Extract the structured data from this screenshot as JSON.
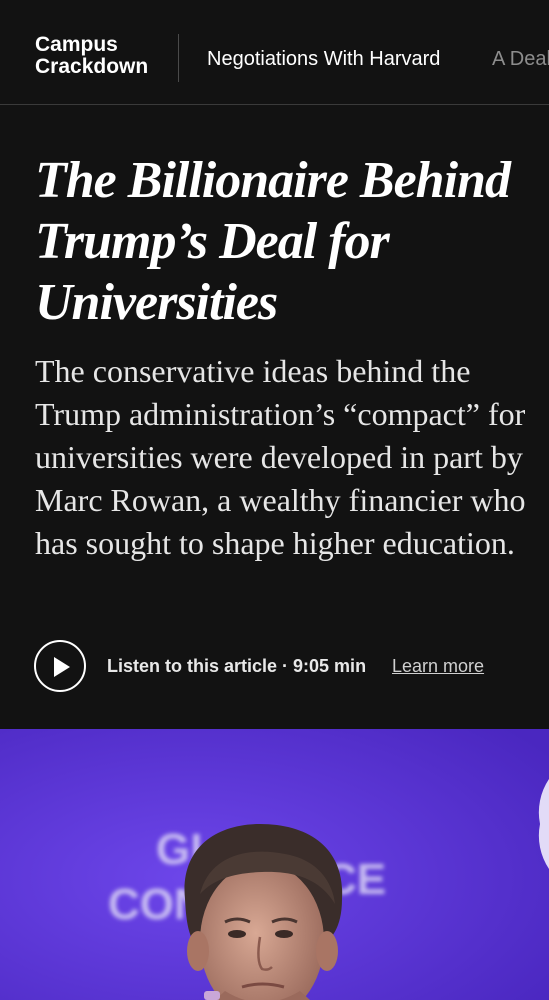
{
  "header": {
    "section_name": "Campus Crackdown",
    "nav_links": [
      "Negotiations With Harvard",
      "A Deal"
    ]
  },
  "article": {
    "headline": "The Billionaire Behind Trump’s Deal for Universities",
    "summary": "The conservative ideas behind the Trump administration’s “compact” for universities were developed in part by Marc Rowan, a wealthy financier who has sought to shape higher education.",
    "audio": {
      "label": "Listen to this article · 9:05 min",
      "learn_more": "Learn more"
    }
  },
  "hero_image": {
    "backdrop_text": "GLOBAL CONFERENCE",
    "visible_text_fragments": [
      "GL",
      "O",
      "CON",
      "CE"
    ],
    "background_color": "#5b33d6"
  },
  "colors": {
    "page_background": "#121212",
    "text_primary": "#ffffff",
    "nav_dim": "#8d8d8d"
  }
}
